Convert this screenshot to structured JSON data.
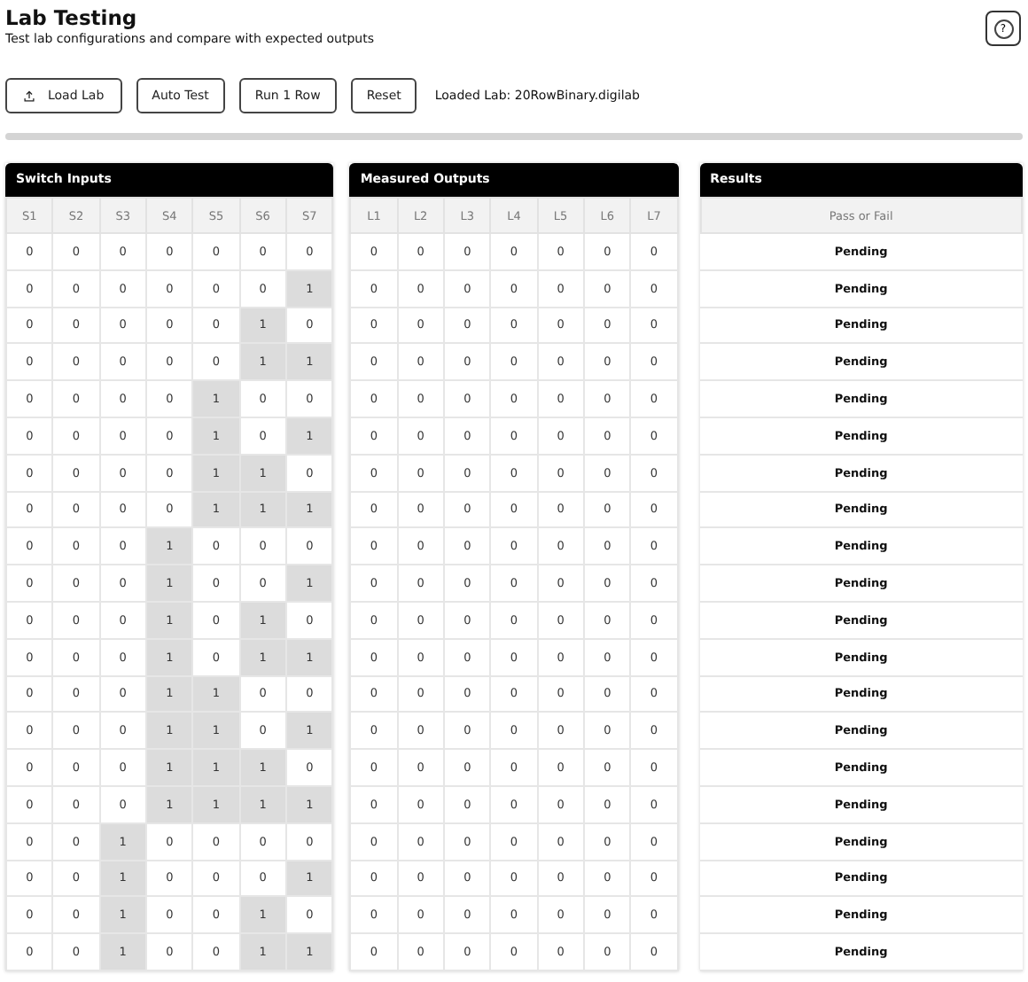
{
  "header": {
    "title": "Lab Testing",
    "subtitle": "Test lab configurations and compare with expected outputs",
    "help_icon": "?"
  },
  "toolbar": {
    "buttons": [
      {
        "label": "Load Lab",
        "kind": "upload"
      },
      {
        "label": "Auto Test",
        "kind": "plain"
      },
      {
        "label": "Run 1 Row",
        "kind": "plain"
      },
      {
        "label": "Reset",
        "kind": "plain"
      }
    ],
    "status": "Loaded Lab: 20RowBinary.digilab"
  },
  "progress": {
    "level": 0
  },
  "switch_inputs": {
    "title": "Switch Inputs",
    "columns": [
      "S1",
      "S2",
      "S3",
      "S4",
      "S5",
      "S6",
      "S7"
    ],
    "rows": [
      {
        "values": [
          "0",
          "0",
          "0",
          "0",
          "0",
          "0",
          "0"
        ],
        "on": [
          false,
          false,
          false,
          false,
          false,
          false,
          false
        ]
      },
      {
        "values": [
          "0",
          "0",
          "0",
          "0",
          "0",
          "0",
          "1"
        ],
        "on": [
          false,
          false,
          false,
          false,
          false,
          false,
          true
        ]
      },
      {
        "values": [
          "0",
          "0",
          "0",
          "0",
          "0",
          "1",
          "0"
        ],
        "on": [
          false,
          false,
          false,
          false,
          false,
          true,
          false
        ]
      },
      {
        "values": [
          "0",
          "0",
          "0",
          "0",
          "0",
          "1",
          "1"
        ],
        "on": [
          false,
          false,
          false,
          false,
          false,
          true,
          true
        ]
      },
      {
        "values": [
          "0",
          "0",
          "0",
          "0",
          "1",
          "0",
          "0"
        ],
        "on": [
          false,
          false,
          false,
          false,
          true,
          false,
          false
        ]
      },
      {
        "values": [
          "0",
          "0",
          "0",
          "0",
          "1",
          "0",
          "1"
        ],
        "on": [
          false,
          false,
          false,
          false,
          true,
          false,
          true
        ]
      },
      {
        "values": [
          "0",
          "0",
          "0",
          "0",
          "1",
          "1",
          "0"
        ],
        "on": [
          false,
          false,
          false,
          false,
          true,
          true,
          false
        ]
      },
      {
        "values": [
          "0",
          "0",
          "0",
          "0",
          "1",
          "1",
          "1"
        ],
        "on": [
          false,
          false,
          false,
          false,
          true,
          true,
          true
        ]
      },
      {
        "values": [
          "0",
          "0",
          "0",
          "1",
          "0",
          "0",
          "0"
        ],
        "on": [
          false,
          false,
          false,
          true,
          false,
          false,
          false
        ]
      },
      {
        "values": [
          "0",
          "0",
          "0",
          "1",
          "0",
          "0",
          "1"
        ],
        "on": [
          false,
          false,
          false,
          true,
          false,
          false,
          true
        ]
      },
      {
        "values": [
          "0",
          "0",
          "0",
          "1",
          "0",
          "1",
          "0"
        ],
        "on": [
          false,
          false,
          false,
          true,
          false,
          true,
          false
        ]
      },
      {
        "values": [
          "0",
          "0",
          "0",
          "1",
          "0",
          "1",
          "1"
        ],
        "on": [
          false,
          false,
          false,
          true,
          false,
          true,
          true
        ]
      },
      {
        "values": [
          "0",
          "0",
          "0",
          "1",
          "1",
          "0",
          "0"
        ],
        "on": [
          false,
          false,
          false,
          true,
          true,
          false,
          false
        ]
      },
      {
        "values": [
          "0",
          "0",
          "0",
          "1",
          "1",
          "0",
          "1"
        ],
        "on": [
          false,
          false,
          false,
          true,
          true,
          false,
          true
        ]
      },
      {
        "values": [
          "0",
          "0",
          "0",
          "1",
          "1",
          "1",
          "0"
        ],
        "on": [
          false,
          false,
          false,
          true,
          true,
          true,
          false
        ]
      },
      {
        "values": [
          "0",
          "0",
          "0",
          "1",
          "1",
          "1",
          "1"
        ],
        "on": [
          false,
          false,
          false,
          true,
          true,
          true,
          true
        ]
      },
      {
        "values": [
          "0",
          "0",
          "1",
          "0",
          "0",
          "0",
          "0"
        ],
        "on": [
          false,
          false,
          true,
          false,
          false,
          false,
          false
        ]
      },
      {
        "values": [
          "0",
          "0",
          "1",
          "0",
          "0",
          "0",
          "1"
        ],
        "on": [
          false,
          false,
          true,
          false,
          false,
          false,
          true
        ]
      },
      {
        "values": [
          "0",
          "0",
          "1",
          "0",
          "0",
          "1",
          "0"
        ],
        "on": [
          false,
          false,
          true,
          false,
          false,
          true,
          false
        ]
      },
      {
        "values": [
          "0",
          "0",
          "1",
          "0",
          "0",
          "1",
          "1"
        ],
        "on": [
          false,
          false,
          true,
          false,
          false,
          true,
          true
        ]
      }
    ]
  },
  "measured_outputs": {
    "title": "Measured Outputs",
    "columns": [
      "L1",
      "L2",
      "L3",
      "L4",
      "L5",
      "L6",
      "L7"
    ],
    "rows": [
      [
        "0",
        "0",
        "0",
        "0",
        "0",
        "0",
        "0"
      ],
      [
        "0",
        "0",
        "0",
        "0",
        "0",
        "0",
        "0"
      ],
      [
        "0",
        "0",
        "0",
        "0",
        "0",
        "0",
        "0"
      ],
      [
        "0",
        "0",
        "0",
        "0",
        "0",
        "0",
        "0"
      ],
      [
        "0",
        "0",
        "0",
        "0",
        "0",
        "0",
        "0"
      ],
      [
        "0",
        "0",
        "0",
        "0",
        "0",
        "0",
        "0"
      ],
      [
        "0",
        "0",
        "0",
        "0",
        "0",
        "0",
        "0"
      ],
      [
        "0",
        "0",
        "0",
        "0",
        "0",
        "0",
        "0"
      ],
      [
        "0",
        "0",
        "0",
        "0",
        "0",
        "0",
        "0"
      ],
      [
        "0",
        "0",
        "0",
        "0",
        "0",
        "0",
        "0"
      ],
      [
        "0",
        "0",
        "0",
        "0",
        "0",
        "0",
        "0"
      ],
      [
        "0",
        "0",
        "0",
        "0",
        "0",
        "0",
        "0"
      ],
      [
        "0",
        "0",
        "0",
        "0",
        "0",
        "0",
        "0"
      ],
      [
        "0",
        "0",
        "0",
        "0",
        "0",
        "0",
        "0"
      ],
      [
        "0",
        "0",
        "0",
        "0",
        "0",
        "0",
        "0"
      ],
      [
        "0",
        "0",
        "0",
        "0",
        "0",
        "0",
        "0"
      ],
      [
        "0",
        "0",
        "0",
        "0",
        "0",
        "0",
        "0"
      ],
      [
        "0",
        "0",
        "0",
        "0",
        "0",
        "0",
        "0"
      ],
      [
        "0",
        "0",
        "0",
        "0",
        "0",
        "0",
        "0"
      ],
      [
        "0",
        "0",
        "0",
        "0",
        "0",
        "0",
        "0"
      ]
    ]
  },
  "results": {
    "title": "Results",
    "column": "Pass or Fail",
    "rows": [
      "Pending",
      "Pending",
      "Pending",
      "Pending",
      "Pending",
      "Pending",
      "Pending",
      "Pending",
      "Pending",
      "Pending",
      "Pending",
      "Pending",
      "Pending",
      "Pending",
      "Pending",
      "Pending",
      "Pending",
      "Pending",
      "Pending",
      "Pending"
    ]
  }
}
